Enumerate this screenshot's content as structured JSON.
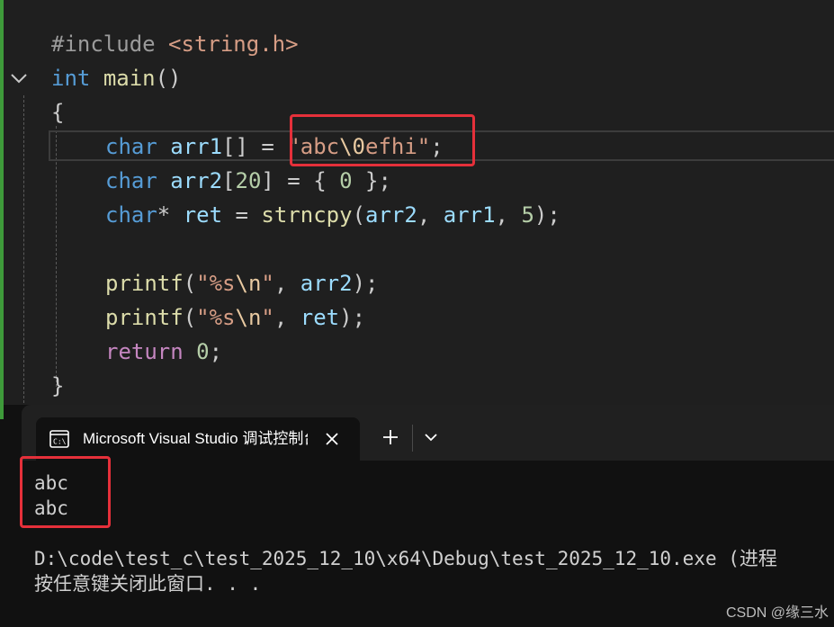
{
  "editor": {
    "lines": [
      {
        "tokens": [
          {
            "t": "#include ",
            "c": "pre"
          },
          {
            "t": "<string.h>",
            "c": "str"
          }
        ]
      },
      {
        "tokens": [
          {
            "t": "int",
            "c": "kw"
          },
          {
            "t": " ",
            "c": "plain"
          },
          {
            "t": "main",
            "c": "fn"
          },
          {
            "t": "()",
            "c": "plain"
          }
        ]
      },
      {
        "tokens": [
          {
            "t": "{",
            "c": "plain"
          }
        ]
      },
      {
        "indent": 1,
        "tokens": [
          {
            "t": "char",
            "c": "kw"
          },
          {
            "t": " ",
            "c": "plain"
          },
          {
            "t": "arr1",
            "c": "var"
          },
          {
            "t": "[] = ",
            "c": "plain"
          },
          {
            "t": "\"abc",
            "c": "str"
          },
          {
            "t": "\\0",
            "c": "esc"
          },
          {
            "t": "efhi\"",
            "c": "str"
          },
          {
            "t": ";",
            "c": "plain"
          }
        ]
      },
      {
        "indent": 1,
        "tokens": [
          {
            "t": "char",
            "c": "kw"
          },
          {
            "t": " ",
            "c": "plain"
          },
          {
            "t": "arr2",
            "c": "var"
          },
          {
            "t": "[",
            "c": "plain"
          },
          {
            "t": "20",
            "c": "num"
          },
          {
            "t": "] = { ",
            "c": "plain"
          },
          {
            "t": "0",
            "c": "num"
          },
          {
            "t": " };",
            "c": "plain"
          }
        ]
      },
      {
        "indent": 1,
        "tokens": [
          {
            "t": "char",
            "c": "kw"
          },
          {
            "t": "* ",
            "c": "plain"
          },
          {
            "t": "ret",
            "c": "var"
          },
          {
            "t": " = ",
            "c": "plain"
          },
          {
            "t": "strncpy",
            "c": "fn"
          },
          {
            "t": "(",
            "c": "plain"
          },
          {
            "t": "arr2",
            "c": "var"
          },
          {
            "t": ", ",
            "c": "plain"
          },
          {
            "t": "arr1",
            "c": "var"
          },
          {
            "t": ", ",
            "c": "plain"
          },
          {
            "t": "5",
            "c": "num"
          },
          {
            "t": ");",
            "c": "plain"
          }
        ]
      },
      {
        "tokens": []
      },
      {
        "indent": 1,
        "tokens": [
          {
            "t": "printf",
            "c": "fn"
          },
          {
            "t": "(",
            "c": "plain"
          },
          {
            "t": "\"%s",
            "c": "str"
          },
          {
            "t": "\\n",
            "c": "esc"
          },
          {
            "t": "\"",
            "c": "str"
          },
          {
            "t": ", ",
            "c": "plain"
          },
          {
            "t": "arr2",
            "c": "var"
          },
          {
            "t": ");",
            "c": "plain"
          }
        ]
      },
      {
        "indent": 1,
        "tokens": [
          {
            "t": "printf",
            "c": "fn"
          },
          {
            "t": "(",
            "c": "plain"
          },
          {
            "t": "\"%s",
            "c": "str"
          },
          {
            "t": "\\n",
            "c": "esc"
          },
          {
            "t": "\"",
            "c": "str"
          },
          {
            "t": ", ",
            "c": "plain"
          },
          {
            "t": "ret",
            "c": "var"
          },
          {
            "t": ");",
            "c": "plain"
          }
        ]
      },
      {
        "indent": 1,
        "tokens": [
          {
            "t": "return",
            "c": "ctrl"
          },
          {
            "t": " ",
            "c": "plain"
          },
          {
            "t": "0",
            "c": "num"
          },
          {
            "t": ";",
            "c": "plain"
          }
        ]
      },
      {
        "tokens": [
          {
            "t": "}",
            "c": "plain"
          }
        ]
      }
    ]
  },
  "terminal": {
    "tab_title": "Microsoft Visual Studio 调试控制台",
    "output": [
      "abc",
      "abc"
    ],
    "exit_path": "D:\\code\\test_c\\test_2025_12_10\\x64\\Debug\\test_2025_12_10.exe (进程",
    "prompt": "按任意键关闭此窗口. . ."
  },
  "watermark": "CSDN @缘三水",
  "colors": {
    "git_added": "#3e9a3a",
    "highlight_box": "#e5303a",
    "keyword": "#569cd6",
    "function": "#dcdcaa",
    "string": "#d69d85"
  },
  "icons": {
    "fold": "chevron-down-icon",
    "tab": "console-icon",
    "close": "close-icon",
    "new_tab": "plus-icon",
    "dropdown": "chevron-down-icon"
  }
}
